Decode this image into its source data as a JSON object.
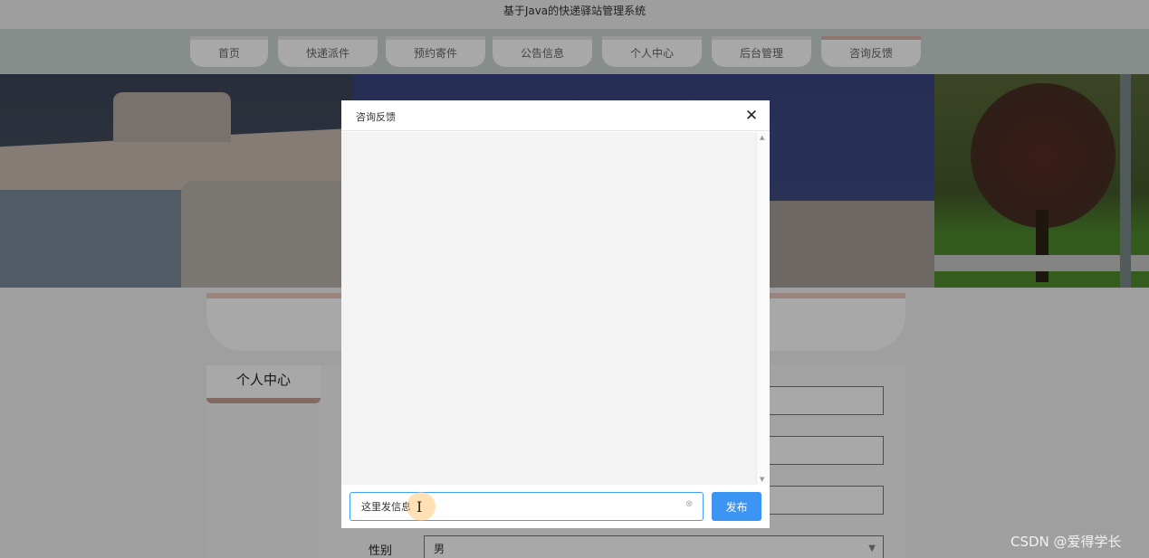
{
  "app": {
    "title": "基于Java的快递驿站管理系统"
  },
  "nav": {
    "tabs": [
      {
        "label": "首页"
      },
      {
        "label": "快递派件"
      },
      {
        "label": "预约寄件"
      },
      {
        "label": "公告信息"
      },
      {
        "label": "个人中心"
      },
      {
        "label": "后台管理"
      },
      {
        "label": "咨询反馈",
        "active": true
      }
    ]
  },
  "sidebar": {
    "title": "个人中心"
  },
  "form": {
    "gender_label": "性别",
    "gender_value": "男"
  },
  "dialog": {
    "title": "咨询反馈",
    "close_glyph": "✕",
    "input_value": "这里发信息",
    "publish_label": "发布"
  },
  "icons": {
    "close": "close-icon",
    "clear": "clear-circle-icon",
    "cursor": "text-cursor-icon",
    "select_arrow": "chevron-down-icon"
  },
  "colors": {
    "accent": "#409eff",
    "publish_button": "#3c95f2",
    "nav_active_border": "#d9b3a8"
  },
  "watermark": "CSDN @爱得学长"
}
